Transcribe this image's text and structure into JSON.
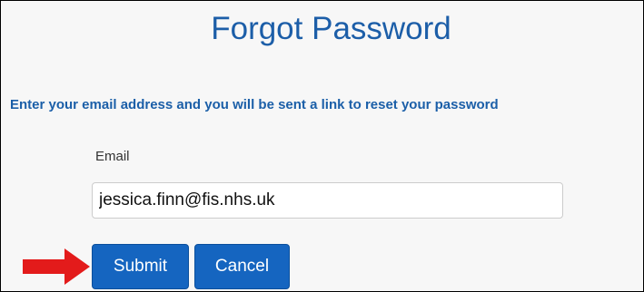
{
  "page": {
    "title": "Forgot Password",
    "instructions": "Enter your email address and you will be sent a link to reset your password"
  },
  "form": {
    "email_label": "Email",
    "email_value": "jessica.finn@fis.nhs.uk",
    "submit_label": "Submit",
    "cancel_label": "Cancel"
  },
  "annotation": {
    "arrow_icon": "red-right-arrow-icon",
    "arrow_color": "#e31b1b"
  },
  "colors": {
    "heading": "#1c5ea8",
    "button": "#1565c0"
  }
}
